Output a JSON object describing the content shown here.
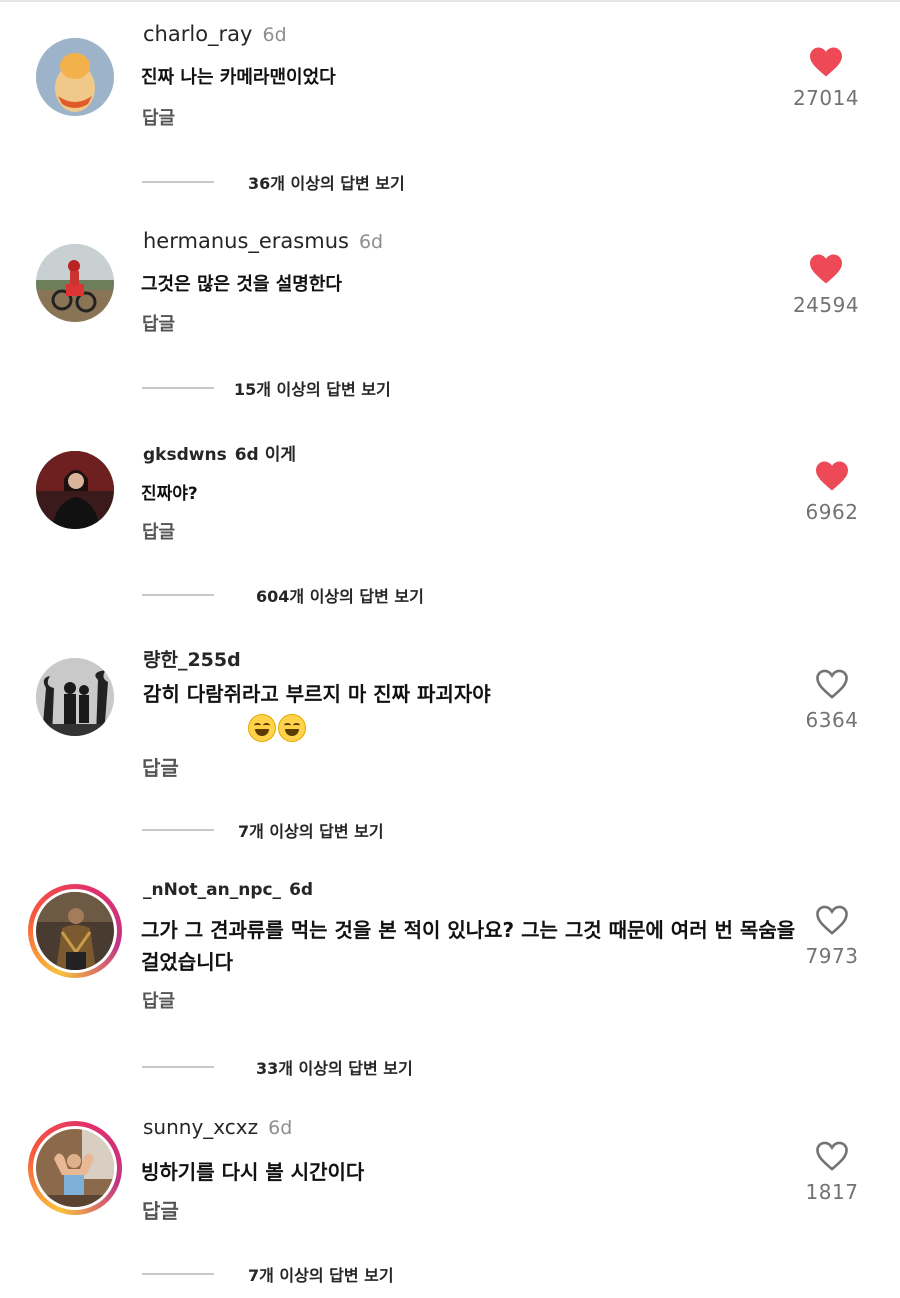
{
  "comments": [
    {
      "username": "charlo_ray",
      "time": "6d",
      "text": "진짜 나는 카메라맨이었다",
      "reply_label": "답글",
      "likes": "27014",
      "liked": true,
      "replies_label": "36개 이상의 답변 보기"
    },
    {
      "username": "hermanus_erasmus",
      "time": "6d",
      "text": "그것은 많은 것을 설명한다",
      "reply_label": "답글",
      "likes": "24594",
      "liked": true,
      "replies_label": "15개 이상의 답변 보기"
    },
    {
      "username": "gksdwns",
      "time": "6d",
      "text_prefix": "이게",
      "text": "진짜야?",
      "reply_label": "답글",
      "likes": "6962",
      "liked": true,
      "replies_label": "604개 이상의 답변 보기"
    },
    {
      "username": "량한_25",
      "time": "5d",
      "text": "감히 다람쥐라고 부르지 마 진짜 파괴자야",
      "reply_label": "답글",
      "likes": "6364",
      "liked": false,
      "replies_label": "7개 이상의 답변 보기"
    },
    {
      "username": "_nNot_an_npc_",
      "time": "6d",
      "text_line1": "그가 그 견과류를 먹는 것을 본 적이 있나요? 그는 그것 때문에 여러 번 목숨을",
      "text_line2": "걸었습니다",
      "reply_label": "답글",
      "likes": "7973",
      "liked": false,
      "replies_label": "33개 이상의 답변 보기"
    },
    {
      "username": "sunny_xcxz",
      "time": "6d",
      "text": "빙하기를 다시 볼 시간이다",
      "reply_label": "답글",
      "likes": "1817",
      "liked": false,
      "replies_label": "7개 이상의 답변 보기"
    }
  ],
  "colors": {
    "heart_filled": "#ed4956",
    "heart_outline": "#737373",
    "text": "#262626"
  }
}
